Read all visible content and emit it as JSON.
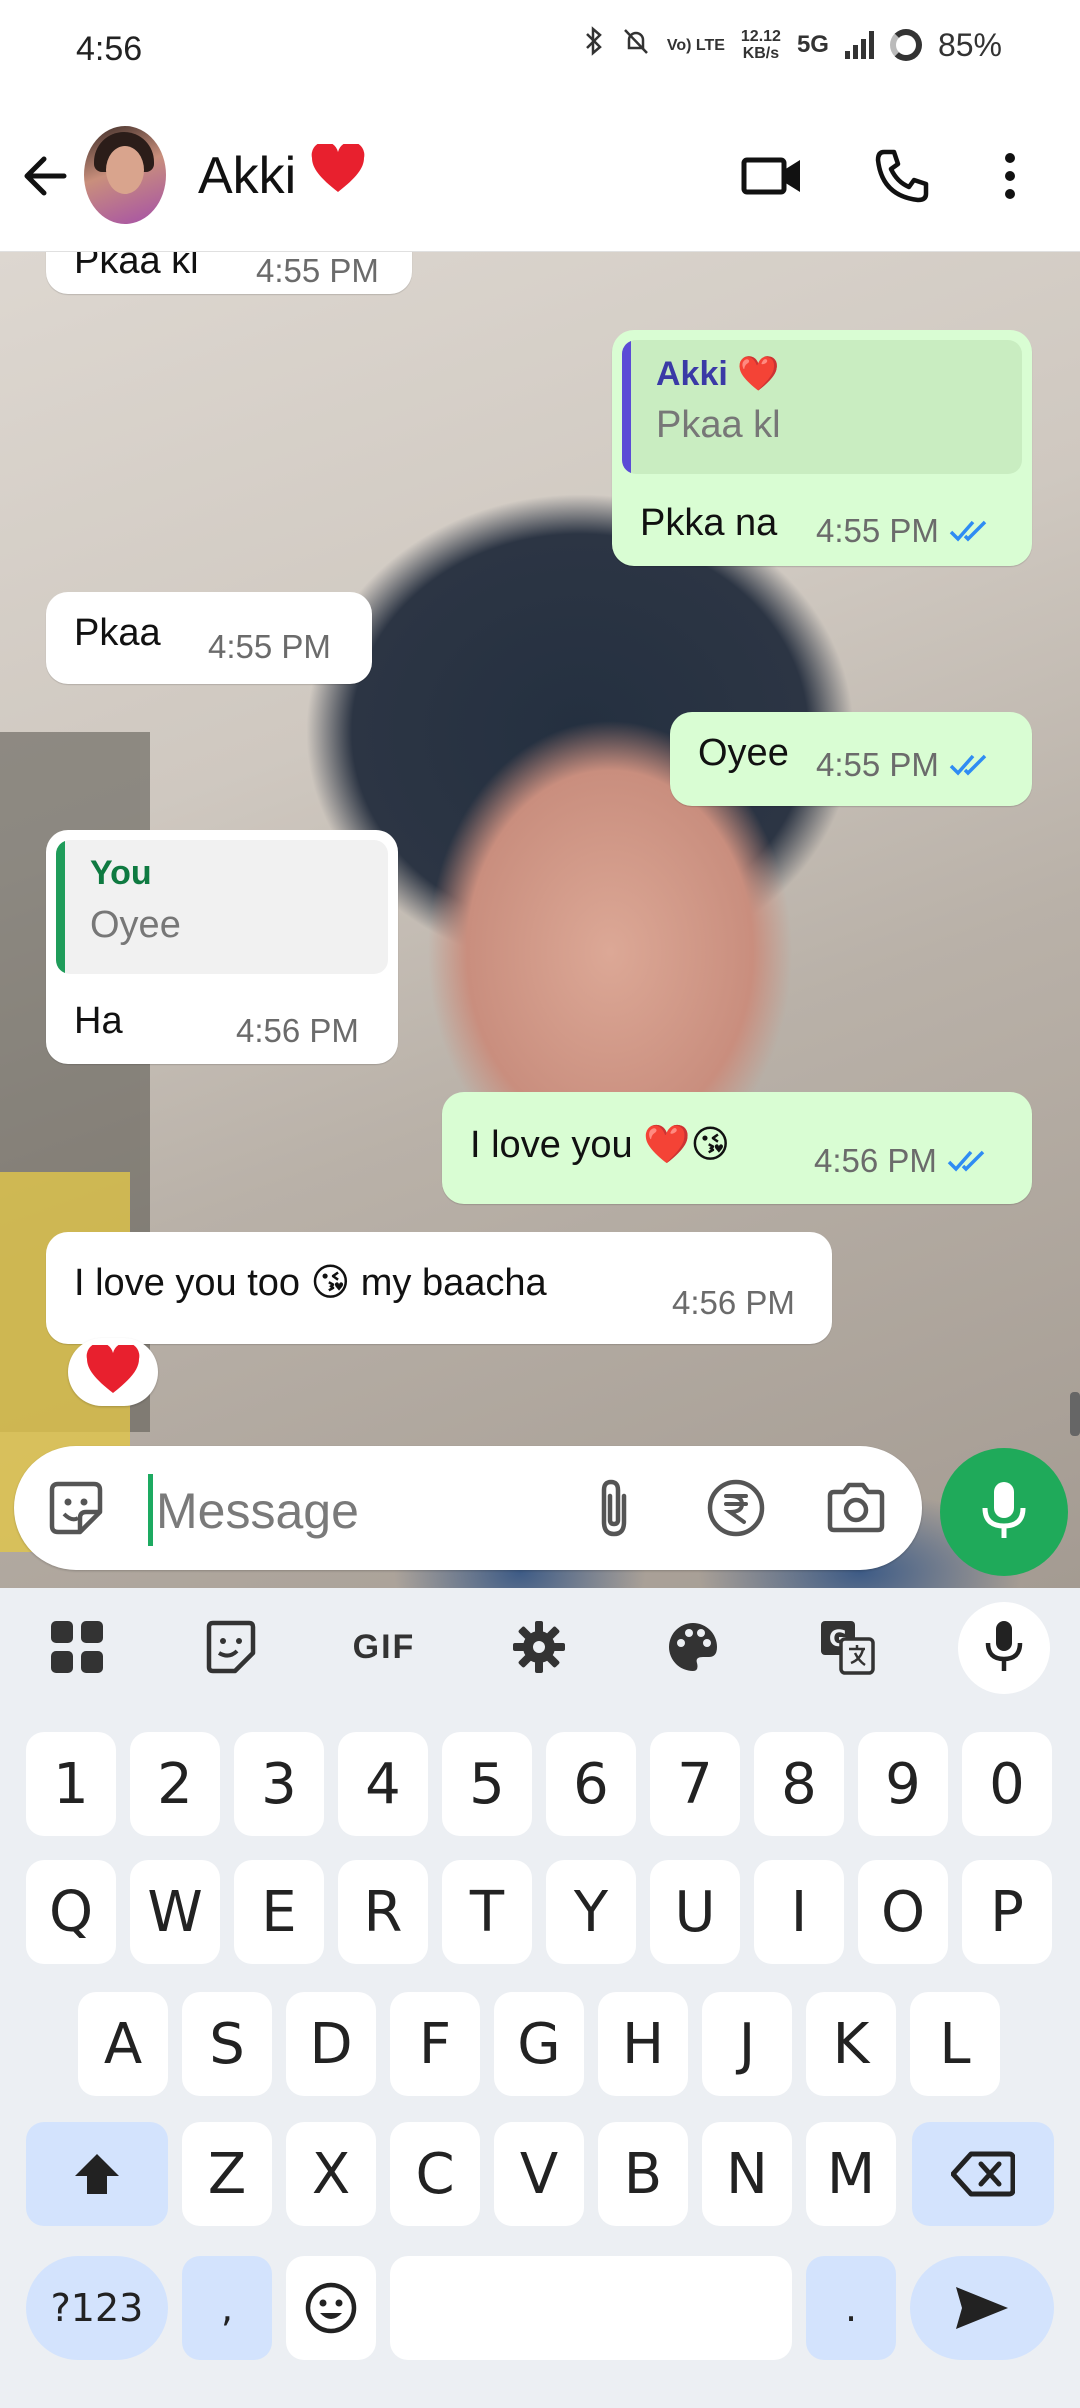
{
  "status_bar": {
    "time": "4:56",
    "net_top": "Vo) LTE",
    "speed_top": "12.12",
    "speed_unit": "KB/s",
    "network": "5G",
    "battery": "85%"
  },
  "header": {
    "contact_name": "Akki",
    "name_emoji": "❤️"
  },
  "messages": [
    {
      "dir": "in",
      "text": "Pkaa kl",
      "time": "4:55 PM"
    },
    {
      "dir": "out",
      "quote_name": "Akki ❤️",
      "quote_text": "Pkaa kl",
      "text": "Pkka na",
      "time": "4:55 PM"
    },
    {
      "dir": "in",
      "text": "Pkaa",
      "time": "4:55 PM"
    },
    {
      "dir": "out",
      "text": "Oyee",
      "time": "4:55 PM"
    },
    {
      "dir": "in",
      "quote_name": "You",
      "quote_text": "Oyee",
      "text": "Ha",
      "time": "4:56 PM"
    },
    {
      "dir": "out",
      "text": "I love you ❤️😘",
      "time": "4:56 PM"
    },
    {
      "dir": "in",
      "text": "I love you too 😘 my baacha",
      "time": "4:56 PM",
      "reaction": "❤️"
    }
  ],
  "input": {
    "placeholder": "Message"
  },
  "keyboard": {
    "toolbar_gif": "GIF",
    "row_numbers": [
      "1",
      "2",
      "3",
      "4",
      "5",
      "6",
      "7",
      "8",
      "9",
      "0"
    ],
    "row_1": [
      "Q",
      "W",
      "E",
      "R",
      "T",
      "Y",
      "U",
      "I",
      "O",
      "P"
    ],
    "row_2": [
      "A",
      "S",
      "D",
      "F",
      "G",
      "H",
      "J",
      "K",
      "L"
    ],
    "row_3": [
      "Z",
      "X",
      "C",
      "V",
      "B",
      "N",
      "M"
    ],
    "symbols_key": "?123",
    "comma_key": ",",
    "period_key": "."
  },
  "colors": {
    "outgoing_bubble": "#d9fdd3",
    "accent_green": "#1faa5a",
    "tick_blue": "#2f8cf3",
    "quote_akki": "#5b4bd6",
    "quote_you": "#1f9c5a"
  }
}
